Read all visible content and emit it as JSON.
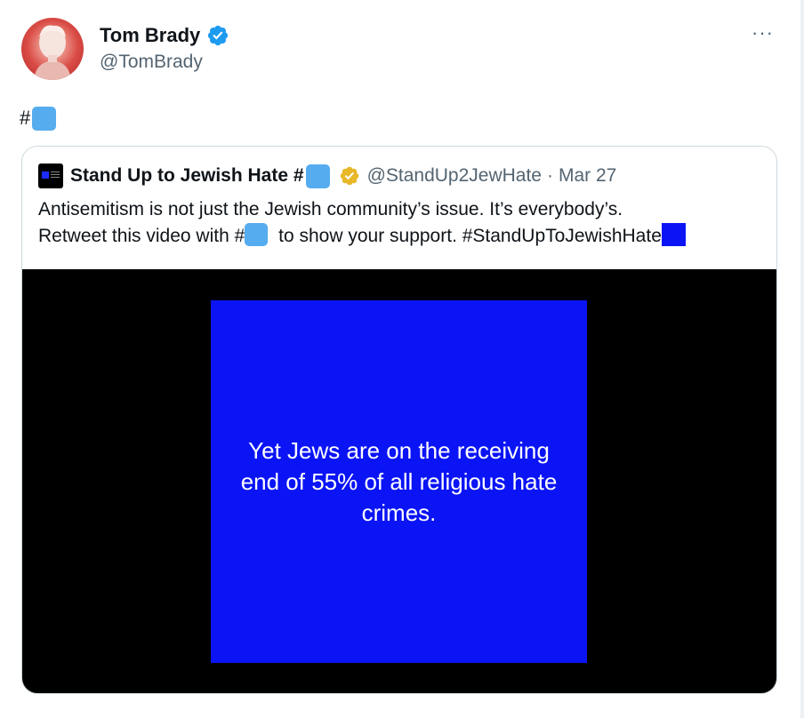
{
  "tweet": {
    "author": {
      "display_name": "Tom Brady",
      "handle": "@TomBrady",
      "verified": true,
      "badge_color": "#1d9bf0"
    },
    "more_label": "···",
    "text_prefix": "#",
    "emoji": "blue-square-emoji"
  },
  "quote": {
    "author": {
      "display_name": "Stand Up to Jewish Hate #",
      "handle": "@StandUp2JewHate",
      "separator": "·",
      "date": "Mar 27",
      "badge_color": "#e8b829"
    },
    "text_line1": "Antisemitism is not just the Jewish community’s issue. It’s everybody’s.",
    "text_line2_a": "Retweet this video with #",
    "text_line2_b": " to show your support. #StandUpToJewishHate",
    "video": {
      "caption": "Yet Jews are on the receiving end of 55% of all religious hate crimes.",
      "frame_color": "#0a14f5"
    }
  },
  "colors": {
    "emoji_blue": "#55acee",
    "secondary_text": "#536471",
    "card_border": "#cfd9de"
  }
}
